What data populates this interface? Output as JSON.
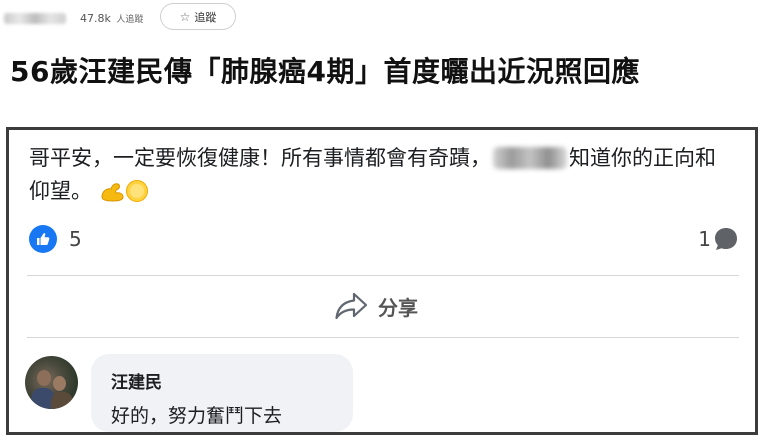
{
  "header": {
    "followers_count": "47.8k",
    "followers_suffix": "人追蹤",
    "follow_button_label": "追蹤"
  },
  "article": {
    "headline": "56歲汪建民傳「肺腺癌4期」首度曬出近況照回應"
  },
  "comment": {
    "text_before_mention": "哥平安，一定要恢復健康！所有事情都會有奇蹟，",
    "text_after_mention": "知道你的正向和仰望。",
    "emojis": [
      "flexed-biceps",
      "sun"
    ],
    "like_count": "5",
    "comment_count": "1"
  },
  "actions": {
    "share_label": "分享"
  },
  "reply": {
    "author": "汪建民",
    "text": "好的，努力奮鬥下去"
  },
  "colors": {
    "like_blue": "#1877f2",
    "bubble_bg": "#f0f2f5",
    "border": "#3c3c3c"
  }
}
